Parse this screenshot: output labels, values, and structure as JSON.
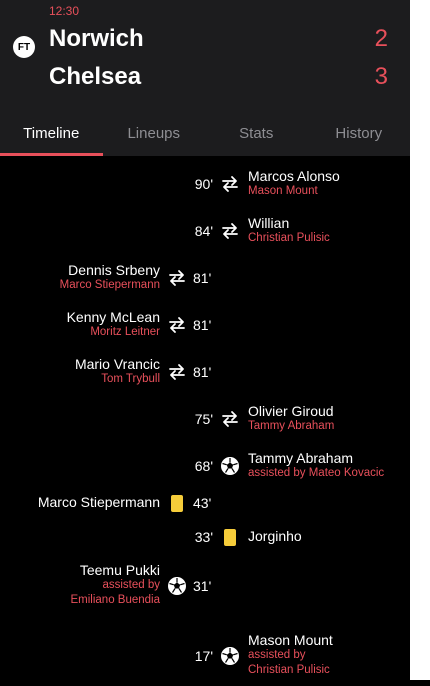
{
  "status_time": "12:30",
  "status_badge": "FT",
  "home": {
    "name": "Norwich",
    "score": "2"
  },
  "away": {
    "name": "Chelsea",
    "score": "3"
  },
  "tabs": [
    "Timeline",
    "Lineups",
    "Stats",
    "History"
  ],
  "colors": {
    "accent": "#e8505b",
    "card_yellow": "#f6cd3a",
    "header_bg": "#1c1c1e"
  },
  "events": [
    {
      "side": "away",
      "type": "substitution",
      "minute": "90'",
      "main": "Marcos Alonso",
      "sub": "Mason Mount"
    },
    {
      "side": "away",
      "type": "substitution",
      "minute": "84'",
      "main": "Willian",
      "sub": "Christian Pulisic"
    },
    {
      "side": "home",
      "type": "substitution",
      "minute": "81'",
      "main": "Dennis Srbeny",
      "sub": "Marco Stiepermann"
    },
    {
      "side": "home",
      "type": "substitution",
      "minute": "81'",
      "main": "Kenny McLean",
      "sub": "Moritz Leitner"
    },
    {
      "side": "home",
      "type": "substitution",
      "minute": "81'",
      "main": "Mario Vrancic",
      "sub": "Tom Trybull"
    },
    {
      "side": "away",
      "type": "substitution",
      "minute": "75'",
      "main": "Olivier Giroud",
      "sub": "Tammy Abraham"
    },
    {
      "side": "away",
      "type": "goal",
      "minute": "68'",
      "main": "Tammy Abraham",
      "sub": "assisted by Mateo Kovacic"
    },
    {
      "side": "home",
      "type": "yellow-card",
      "minute": "43'",
      "main": "Marco Stiepermann",
      "sub": ""
    },
    {
      "side": "away",
      "type": "yellow-card",
      "minute": "33'",
      "main": "Jorginho",
      "sub": ""
    },
    {
      "side": "home",
      "type": "goal",
      "minute": "31'",
      "main": "Teemu Pukki",
      "sub": "assisted by",
      "sub2": "Emiliano Buendia"
    },
    {
      "side": "away",
      "type": "goal",
      "minute": "17'",
      "main": "Mason Mount",
      "sub": "assisted by",
      "sub2": "Christian Pulisic"
    }
  ]
}
